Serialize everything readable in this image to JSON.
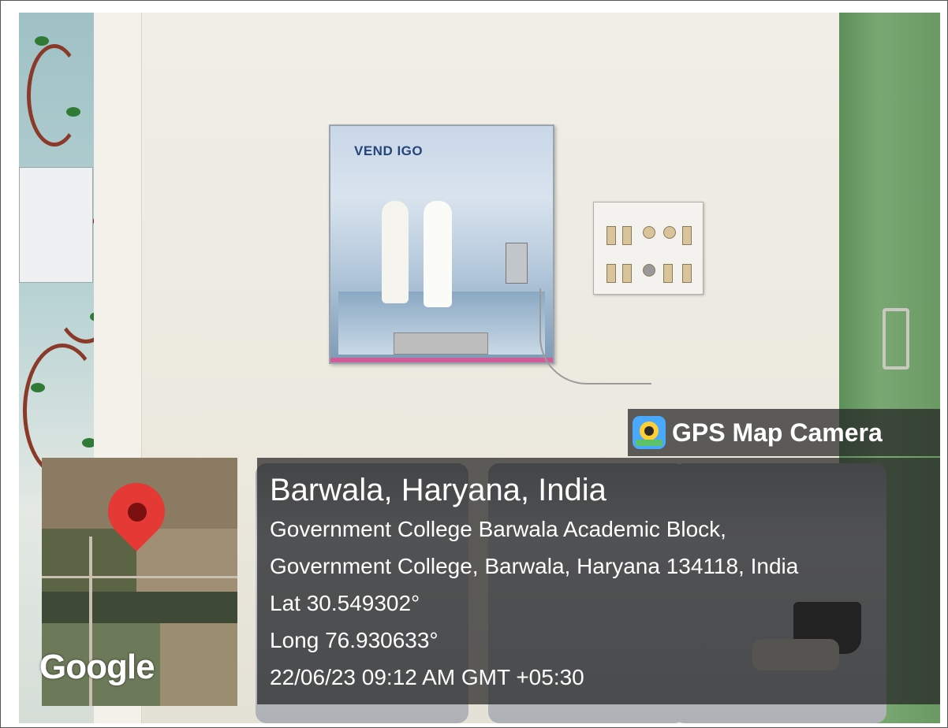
{
  "photo": {
    "vending_brand": "VEND IGO"
  },
  "gps_overlay": {
    "app_name": "GPS Map Camera",
    "place": "Barwala, Haryana, India",
    "address_line_1": "Government College Barwala Academic Block,",
    "address_line_2": "Government College, Barwala, Haryana 134118, India",
    "latitude": "Lat 30.549302°",
    "longitude": "Long 76.930633°",
    "datetime": "22/06/23 09:12 AM GMT +05:30"
  },
  "map_thumbnail": {
    "attribution": "Google",
    "pin_color": "#e53935"
  },
  "icons": {
    "app_icon": "gps-map-camera-icon",
    "pin_icon": "map-pin-icon"
  }
}
